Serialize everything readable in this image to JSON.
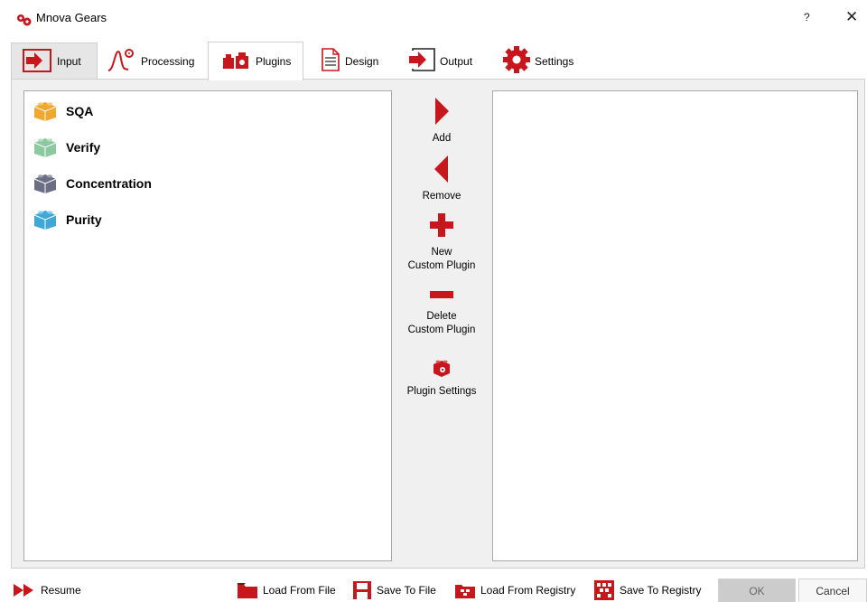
{
  "window": {
    "title": "Mnova Gears",
    "help_label": "?",
    "close_label": "✕"
  },
  "tabs": [
    {
      "label": "Input",
      "icon": "arrow-in-icon"
    },
    {
      "label": "Processing",
      "icon": "peak-gear-icon"
    },
    {
      "label": "Plugins",
      "icon": "plugin-bricks-icon"
    },
    {
      "label": "Design",
      "icon": "document-icon"
    },
    {
      "label": "Output",
      "icon": "arrow-out-icon"
    },
    {
      "label": "Settings",
      "icon": "gear-icon"
    }
  ],
  "active_tab": "Plugins",
  "available_plugins": [
    {
      "label": "SQA",
      "color": "#f0a830"
    },
    {
      "label": "Verify",
      "color": "#8cc9a0"
    },
    {
      "label": "Concentration",
      "color": "#6b6f86"
    },
    {
      "label": "Purity",
      "color": "#3fa8d8"
    }
  ],
  "selected_plugins": [],
  "actions": {
    "add": "Add",
    "remove": "Remove",
    "new_custom": "New\nCustom Plugin",
    "delete_custom": "Delete\nCustom Plugin",
    "plugin_settings": "Plugin Settings"
  },
  "bottom": {
    "resume": "Resume",
    "load_file": "Load From File",
    "save_file": "Save To File",
    "load_registry": "Load From Registry",
    "save_registry": "Save To Registry",
    "ok": "OK",
    "cancel": "Cancel"
  },
  "colors": {
    "accent_red": "#c8161d",
    "tab_active_bg": "#ffffff",
    "panel_bg": "#f0f0f0"
  }
}
